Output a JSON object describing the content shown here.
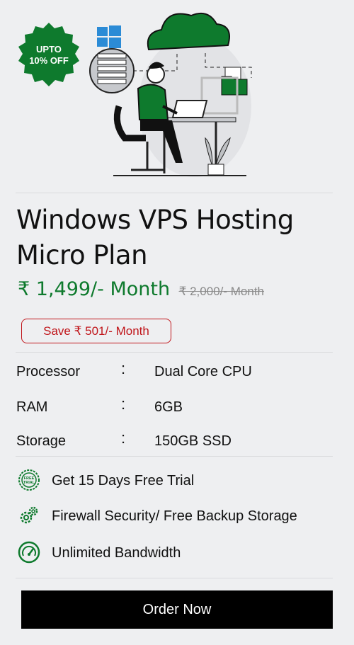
{
  "badge": {
    "line1": "UPTO",
    "line2": "10% OFF",
    "color": "#0e7a2d"
  },
  "plan": {
    "title_line1": "Windows VPS Hosting",
    "title_line2": "Micro Plan",
    "price": "₹ 1,499/- Month",
    "old_price": "₹ 2,000/- Month",
    "save": "Save  ₹ 501/- Month"
  },
  "specs": [
    {
      "label": "Processor",
      "colon": ":",
      "value": "Dual Core CPU"
    },
    {
      "label": "RAM",
      "colon": ":",
      "value": "6GB"
    },
    {
      "label": "Storage",
      "colon": ":",
      "value": "150GB SSD"
    }
  ],
  "features": [
    {
      "icon": "free-trial-icon",
      "text": "Get 15 Days Free Trial"
    },
    {
      "icon": "gears-icon",
      "text": "Firewall Security/ Free Backup Storage"
    },
    {
      "icon": "speedometer-icon",
      "text": "Unlimited Bandwidth"
    }
  ],
  "order_button": "Order Now",
  "colors": {
    "accent": "#0e7a2d",
    "danger": "#c0151a",
    "button": "#000000"
  }
}
